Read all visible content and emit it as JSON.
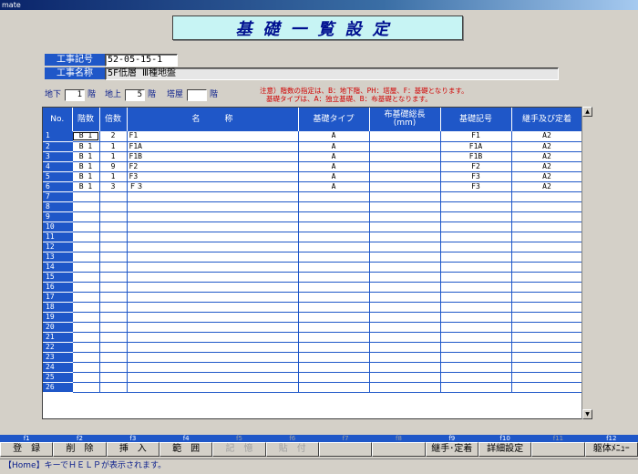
{
  "window": {
    "title": "mate"
  },
  "banner": {
    "title": "基礎一覧設定"
  },
  "job": {
    "record_label": "工事記号",
    "record_value": "52-05-15-1",
    "name_label": "工事名称",
    "name_value": "5F低層 Ⅲ種地盤"
  },
  "floors": {
    "underground_label": "地下",
    "underground_value": "1",
    "above_label": "地上",
    "above_value": "5",
    "tower_label": "塔屋",
    "tower_value": "",
    "unit": "階"
  },
  "note": {
    "line1": "注意）階数の指定は、B：地下階、PH：塔屋、F：基礎となります。",
    "line2": "基礎タイプは、A：独立基礎、B：布基礎となります。"
  },
  "table": {
    "headers": [
      "No.",
      "階数",
      "倍数",
      "名　　　称",
      "基礎タイプ",
      "布基礎総長\n(mm)",
      "基礎記号",
      "継手及び定着"
    ],
    "rows": [
      [
        "1",
        "B 1",
        "2",
        "F1",
        "A",
        "",
        "F1",
        "A2"
      ],
      [
        "2",
        "B 1",
        "1",
        "F1A",
        "A",
        "",
        "F1A",
        "A2"
      ],
      [
        "3",
        "B 1",
        "1",
        "F1B",
        "A",
        "",
        "F1B",
        "A2"
      ],
      [
        "4",
        "B 1",
        "9",
        "F2",
        "A",
        "",
        "F2",
        "A2"
      ],
      [
        "5",
        "B 1",
        "1",
        "F3",
        "A",
        "",
        "F3",
        "A2"
      ],
      [
        "6",
        "B 1",
        "3",
        "Ｆ３",
        "A",
        "",
        "F3",
        "A2"
      ],
      [
        "7",
        "",
        "",
        "",
        "",
        "",
        "",
        ""
      ],
      [
        "8",
        "",
        "",
        "",
        "",
        "",
        "",
        ""
      ],
      [
        "9",
        "",
        "",
        "",
        "",
        "",
        "",
        ""
      ],
      [
        "10",
        "",
        "",
        "",
        "",
        "",
        "",
        ""
      ],
      [
        "11",
        "",
        "",
        "",
        "",
        "",
        "",
        ""
      ],
      [
        "12",
        "",
        "",
        "",
        "",
        "",
        "",
        ""
      ],
      [
        "13",
        "",
        "",
        "",
        "",
        "",
        "",
        ""
      ],
      [
        "14",
        "",
        "",
        "",
        "",
        "",
        "",
        ""
      ],
      [
        "15",
        "",
        "",
        "",
        "",
        "",
        "",
        ""
      ],
      [
        "16",
        "",
        "",
        "",
        "",
        "",
        "",
        ""
      ],
      [
        "17",
        "",
        "",
        "",
        "",
        "",
        "",
        ""
      ],
      [
        "18",
        "",
        "",
        "",
        "",
        "",
        "",
        ""
      ],
      [
        "19",
        "",
        "",
        "",
        "",
        "",
        "",
        ""
      ],
      [
        "20",
        "",
        "",
        "",
        "",
        "",
        "",
        ""
      ],
      [
        "21",
        "",
        "",
        "",
        "",
        "",
        "",
        ""
      ],
      [
        "22",
        "",
        "",
        "",
        "",
        "",
        "",
        ""
      ],
      [
        "23",
        "",
        "",
        "",
        "",
        "",
        "",
        ""
      ],
      [
        "24",
        "",
        "",
        "",
        "",
        "",
        "",
        ""
      ],
      [
        "25",
        "",
        "",
        "",
        "",
        "",
        "",
        ""
      ],
      [
        "26",
        "",
        "",
        "",
        "",
        "",
        "",
        ""
      ]
    ]
  },
  "fkeys": [
    {
      "key": "f1",
      "label": "登　録",
      "enabled": true
    },
    {
      "key": "f2",
      "label": "削　除",
      "enabled": true
    },
    {
      "key": "f3",
      "label": "挿　入",
      "enabled": true
    },
    {
      "key": "f4",
      "label": "範　囲",
      "enabled": true
    },
    {
      "key": "f5",
      "label": "記　憶",
      "enabled": false
    },
    {
      "key": "f6",
      "label": "貼　付",
      "enabled": false
    },
    {
      "key": "f7",
      "label": "",
      "enabled": false
    },
    {
      "key": "f8",
      "label": "",
      "enabled": false
    },
    {
      "key": "f9",
      "label": "継手･定着",
      "enabled": true
    },
    {
      "key": "f10",
      "label": "詳細設定",
      "enabled": true
    },
    {
      "key": "f11",
      "label": "",
      "enabled": false
    },
    {
      "key": "f12",
      "label": "躯体ﾒﾆｭｰ",
      "enabled": true
    }
  ],
  "status": {
    "text": "【Home】キーでＨＥＬＰが表示されます。"
  },
  "icons": {
    "scroll_up": "scroll-up-arrow-icon",
    "scroll_down": "scroll-down-arrow-icon"
  },
  "colors": {
    "header_blue": "#1f57c8",
    "banner_bg": "#c7f4f4",
    "note_red": "#d00000"
  }
}
